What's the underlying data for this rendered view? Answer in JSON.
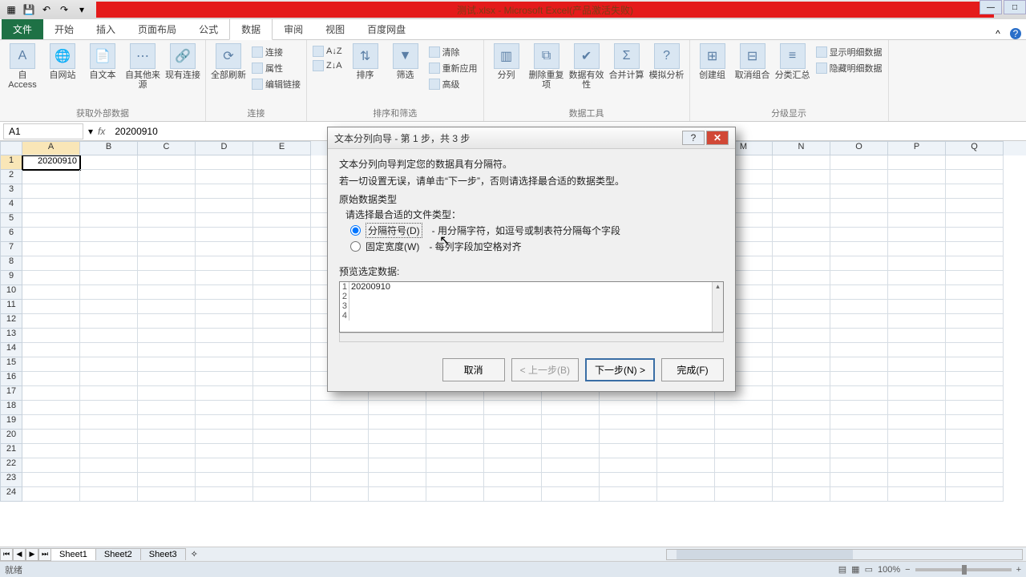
{
  "titlebar": {
    "title": "测试.xlsx - Microsoft Excel(产品激活失败)",
    "qat_icons": [
      "excel-icon",
      "save-icon",
      "undo-icon",
      "redo-icon"
    ]
  },
  "tabs": {
    "file": "文件",
    "items": [
      "开始",
      "插入",
      "页面布局",
      "公式",
      "数据",
      "审阅",
      "视图",
      "百度网盘"
    ],
    "active_index": 4
  },
  "ribbon": {
    "group_external": {
      "label": "获取外部数据",
      "btns": [
        "自 Access",
        "自网站",
        "自文本",
        "自其他来源",
        "现有连接"
      ]
    },
    "group_refresh": {
      "label": "连接",
      "btn": "全部刷新",
      "mini": [
        "连接",
        "属性",
        "编辑链接"
      ]
    },
    "group_sort": {
      "label": "排序和筛选",
      "sort_btns": [
        "A↓Z",
        "Z↓A"
      ],
      "sort": "排序",
      "filter": "筛选",
      "mini": [
        "清除",
        "重新应用",
        "高级"
      ]
    },
    "group_tools": {
      "label": "数据工具",
      "btns": [
        "分列",
        "删除重复项",
        "数据有效性",
        "合并计算",
        "模拟分析"
      ]
    },
    "group_outline": {
      "label": "分级显示",
      "btns": [
        "创建组",
        "取消组合",
        "分类汇总"
      ],
      "mini": [
        "显示明细数据",
        "隐藏明细数据"
      ]
    }
  },
  "formula_bar": {
    "name": "A1",
    "fx": "fx",
    "value": "20200910"
  },
  "grid": {
    "columns": [
      "A",
      "B",
      "C",
      "D",
      "E",
      "M",
      "N",
      "O",
      "P",
      "Q"
    ],
    "a1": "20200910"
  },
  "sheets": {
    "tabs": [
      "Sheet1",
      "Sheet2",
      "Sheet3"
    ]
  },
  "statusbar": {
    "left": "就绪",
    "views": [
      "normal",
      "page-layout",
      "page-break"
    ],
    "zoom": "100%"
  },
  "dialog": {
    "title": "文本分列向导 - 第 1 步，共 3 步",
    "intro1": "文本分列向导判定您的数据具有分隔符。",
    "intro2": "若一切设置无误，请单击“下一步”，否则请选择最合适的数据类型。",
    "ftype_legend": "原始数据类型",
    "ftype_prompt": "请选择最合适的文件类型：",
    "opt1_label": "分隔符号(D)",
    "opt1_desc": "- 用分隔字符，如逗号或制表符分隔每个字段",
    "opt2_label": "固定宽度(W)",
    "opt2_desc": "- 每列字段加空格对齐",
    "preview_label": "预览选定数据:",
    "preview_rows": [
      {
        "n": "1",
        "v": "20200910"
      },
      {
        "n": "2",
        "v": ""
      },
      {
        "n": "3",
        "v": ""
      },
      {
        "n": "4",
        "v": ""
      }
    ],
    "btn_cancel": "取消",
    "btn_back": "< 上一步(B)",
    "btn_next": "下一步(N) >",
    "btn_finish": "完成(F)"
  }
}
